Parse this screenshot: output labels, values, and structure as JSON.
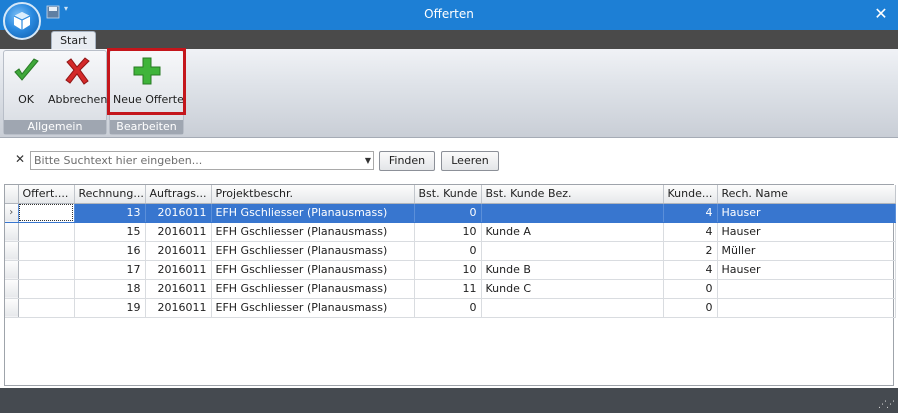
{
  "window": {
    "title": "Offerten",
    "close_glyph": "✕"
  },
  "tabs": [
    {
      "label": "Start"
    }
  ],
  "ribbon": {
    "groups": [
      {
        "label": "Allgemein",
        "buttons": [
          {
            "label": "OK",
            "icon": "check-icon"
          },
          {
            "label": "Abbrechen",
            "icon": "cancel-x-icon"
          }
        ]
      },
      {
        "label": "Bearbeiten",
        "buttons": [
          {
            "label": "Neue Offerte",
            "icon": "plus-icon"
          }
        ]
      }
    ],
    "highlight_color": "#c4161c"
  },
  "search": {
    "clear_glyph": "✕",
    "placeholder": "Bitte Suchtext hier eingeben...",
    "value": "",
    "find_label": "Finden",
    "clear_label": "Leeren"
  },
  "grid": {
    "columns": [
      "Offert....",
      "Rechnung...",
      "Auftrags...",
      "Projektbeschr.",
      "Bst. Kunde",
      "Bst. Kunde Bez.",
      "Kunde...",
      "Rech. Name"
    ],
    "selected_row": 0,
    "selection_color": "#3876cf",
    "rows": [
      [
        "",
        "13",
        "2016011",
        "EFH Gschliesser (Planausmass)",
        "0",
        "",
        "4",
        "Hauser"
      ],
      [
        "",
        "15",
        "2016011",
        "EFH Gschliesser (Planausmass)",
        "10",
        "Kunde A",
        "4",
        "Hauser"
      ],
      [
        "",
        "16",
        "2016011",
        "EFH Gschliesser (Planausmass)",
        "0",
        "",
        "2",
        "Müller"
      ],
      [
        "",
        "17",
        "2016011",
        "EFH Gschliesser (Planausmass)",
        "10",
        "Kunde B",
        "4",
        "Hauser"
      ],
      [
        "",
        "18",
        "2016011",
        "EFH Gschliesser (Planausmass)",
        "11",
        "Kunde C",
        "0",
        ""
      ],
      [
        "",
        "19",
        "2016011",
        "EFH Gschliesser (Planausmass)",
        "0",
        "",
        "0",
        ""
      ]
    ]
  },
  "colors": {
    "titlebar": "#1d7fd5",
    "statusbar": "#454a50"
  }
}
